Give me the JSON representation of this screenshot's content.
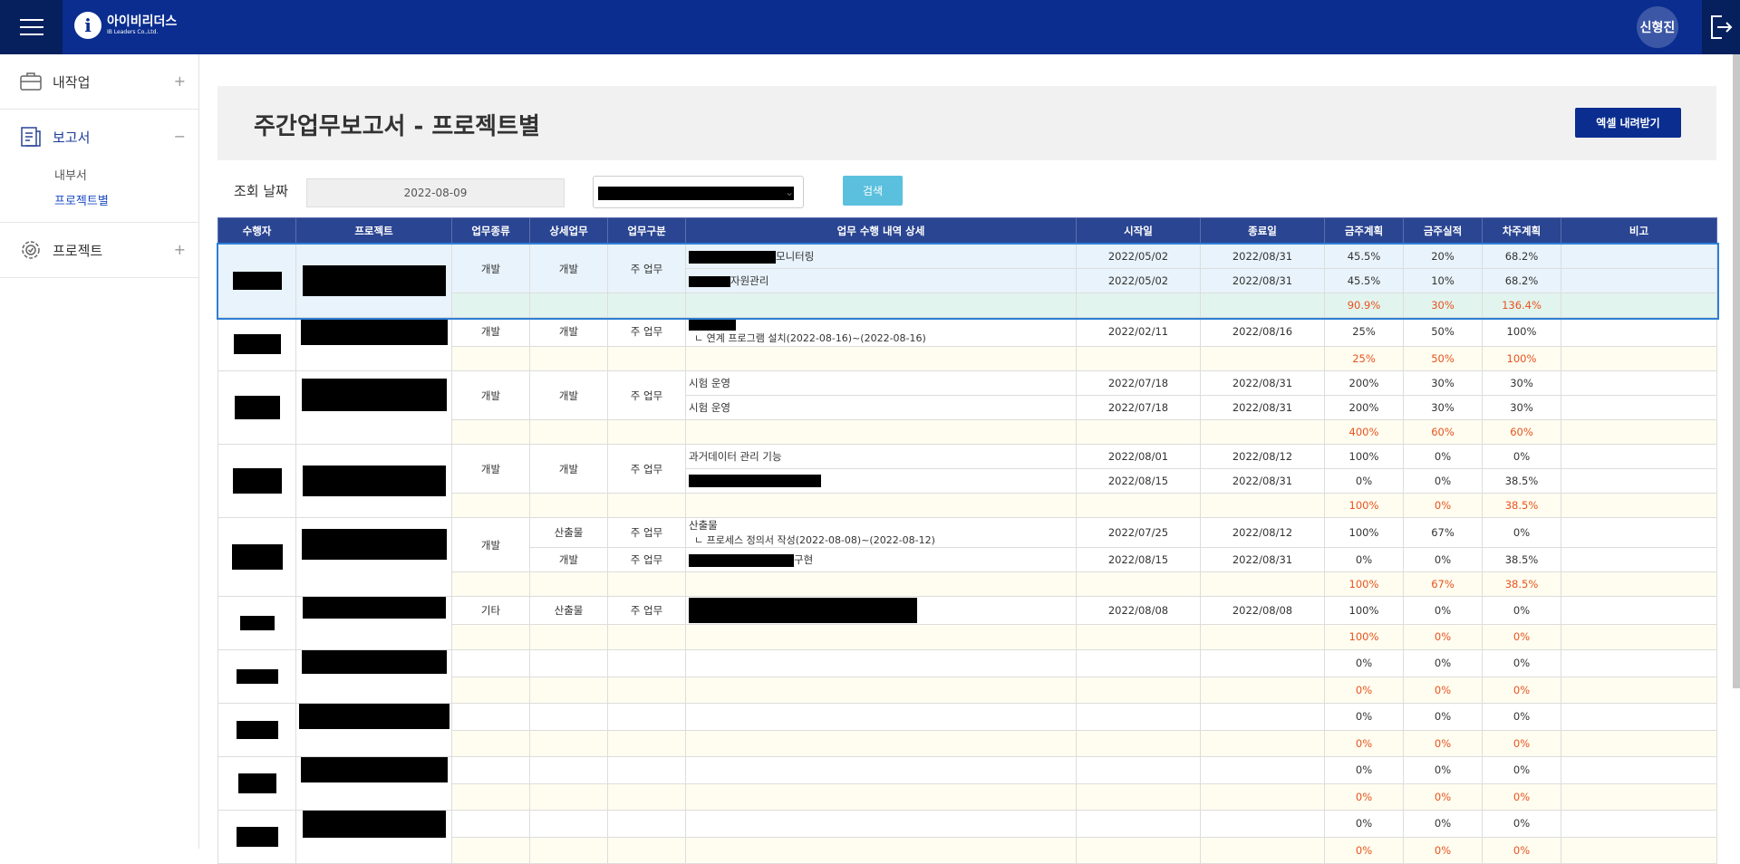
{
  "header": {
    "logo_mark": "i",
    "logo_ko": "아이비리더스",
    "logo_en": "IB Leaders Co.,Ltd.",
    "user": "신형진"
  },
  "sidebar": {
    "items": [
      {
        "label": "내작업",
        "toggle": "+",
        "icon": "briefcase-icon"
      },
      {
        "label": "보고서",
        "toggle": "−",
        "icon": "report-icon",
        "sub": [
          "내부서",
          "프로젝트별"
        ]
      },
      {
        "label": "프로젝트",
        "toggle": "+",
        "icon": "gear-icon"
      }
    ]
  },
  "page": {
    "title": "주간업무보고서 - 프로젝트별",
    "excel_button": "엑셀 내려받기",
    "filter_label": "조회 날짜",
    "date_value": "2022-08-09",
    "search_button": "검색"
  },
  "table": {
    "headers": [
      "수행자",
      "프로젝트",
      "업무종류",
      "상세업무",
      "업무구분",
      "업무 수행 내역 상세",
      "시작일",
      "종료일",
      "금주계획",
      "금주실적",
      "차주계획",
      "비고"
    ],
    "groups": [
      {
        "type": "개발",
        "detail": "개발",
        "div": "주 업무",
        "rows": [
          {
            "text": "모니터링",
            "start": "2022/05/02",
            "end": "2022/08/31",
            "plan": "45.5%",
            "actual": "20%",
            "next": "68.2%"
          },
          {
            "text": "자원관리",
            "start": "2022/05/02",
            "end": "2022/08/31",
            "plan": "45.5%",
            "actual": "10%",
            "next": "68.2%"
          }
        ],
        "sum": {
          "plan": "90.9%",
          "actual": "30%",
          "next": "136.4%"
        }
      },
      {
        "type": "개발",
        "detail": "개발",
        "div": "주 업무",
        "rows": [
          {
            "sub": "ㄴ 연계 프로그램 설치(2022-08-16)~(2022-08-16)",
            "start": "2022/02/11",
            "end": "2022/08/16",
            "plan": "25%",
            "actual": "50%",
            "next": "100%"
          }
        ],
        "sum": {
          "plan": "25%",
          "actual": "50%",
          "next": "100%"
        }
      },
      {
        "type": "개발",
        "detail": "개발",
        "div": "주 업무",
        "rows": [
          {
            "text": "시험 운영",
            "start": "2022/07/18",
            "end": "2022/08/31",
            "plan": "200%",
            "actual": "30%",
            "next": "30%"
          },
          {
            "text": "시험 운영",
            "start": "2022/07/18",
            "end": "2022/08/31",
            "plan": "200%",
            "actual": "30%",
            "next": "30%"
          }
        ],
        "sum": {
          "plan": "400%",
          "actual": "60%",
          "next": "60%"
        }
      },
      {
        "type": "개발",
        "detail": "개발",
        "div": "주 업무",
        "rows": [
          {
            "text": "과거데이터 관리 기능",
            "start": "2022/08/01",
            "end": "2022/08/12",
            "plan": "100%",
            "actual": "0%",
            "next": "0%"
          },
          {
            "text": "",
            "start": "2022/08/15",
            "end": "2022/08/31",
            "plan": "0%",
            "actual": "0%",
            "next": "38.5%"
          }
        ],
        "sum": {
          "plan": "100%",
          "actual": "0%",
          "next": "38.5%"
        }
      },
      {
        "type": "개발",
        "detail": "산출물",
        "div": "주 업무",
        "rows": [
          {
            "text": "산출물",
            "sub": "ㄴ 프로세스 정의서 작성(2022-08-08)~(2022-08-12)",
            "detail": "산출물",
            "div": "주 업무",
            "start": "2022/07/25",
            "end": "2022/08/12",
            "plan": "100%",
            "actual": "67%",
            "next": "0%"
          },
          {
            "text": "구현",
            "detail": "개발",
            "div": "주 업무",
            "start": "2022/08/15",
            "end": "2022/08/31",
            "plan": "0%",
            "actual": "0%",
            "next": "38.5%"
          }
        ],
        "sum": {
          "plan": "100%",
          "actual": "67%",
          "next": "38.5%"
        }
      },
      {
        "type": "기타",
        "detail": "산출물",
        "div": "주 업무",
        "rows": [
          {
            "text": "",
            "start": "2022/08/08",
            "end": "2022/08/08",
            "plan": "100%",
            "actual": "0%",
            "next": "0%"
          }
        ],
        "sum": {
          "plan": "100%",
          "actual": "0%",
          "next": "0%"
        }
      },
      {
        "rows": [
          {
            "plan": "0%",
            "actual": "0%",
            "next": "0%"
          }
        ],
        "sum": {
          "plan": "0%",
          "actual": "0%",
          "next": "0%"
        }
      },
      {
        "rows": [
          {
            "plan": "0%",
            "actual": "0%",
            "next": "0%"
          }
        ],
        "sum": {
          "plan": "0%",
          "actual": "0%",
          "next": "0%"
        }
      },
      {
        "rows": [
          {
            "plan": "0%",
            "actual": "0%",
            "next": "0%"
          }
        ],
        "sum": {
          "plan": "0%",
          "actual": "0%",
          "next": "0%"
        }
      },
      {
        "rows": [
          {
            "plan": "0%",
            "actual": "0%",
            "next": "0%"
          }
        ],
        "sum": {
          "plan": "0%",
          "actual": "0%",
          "next": "0%"
        }
      }
    ]
  }
}
